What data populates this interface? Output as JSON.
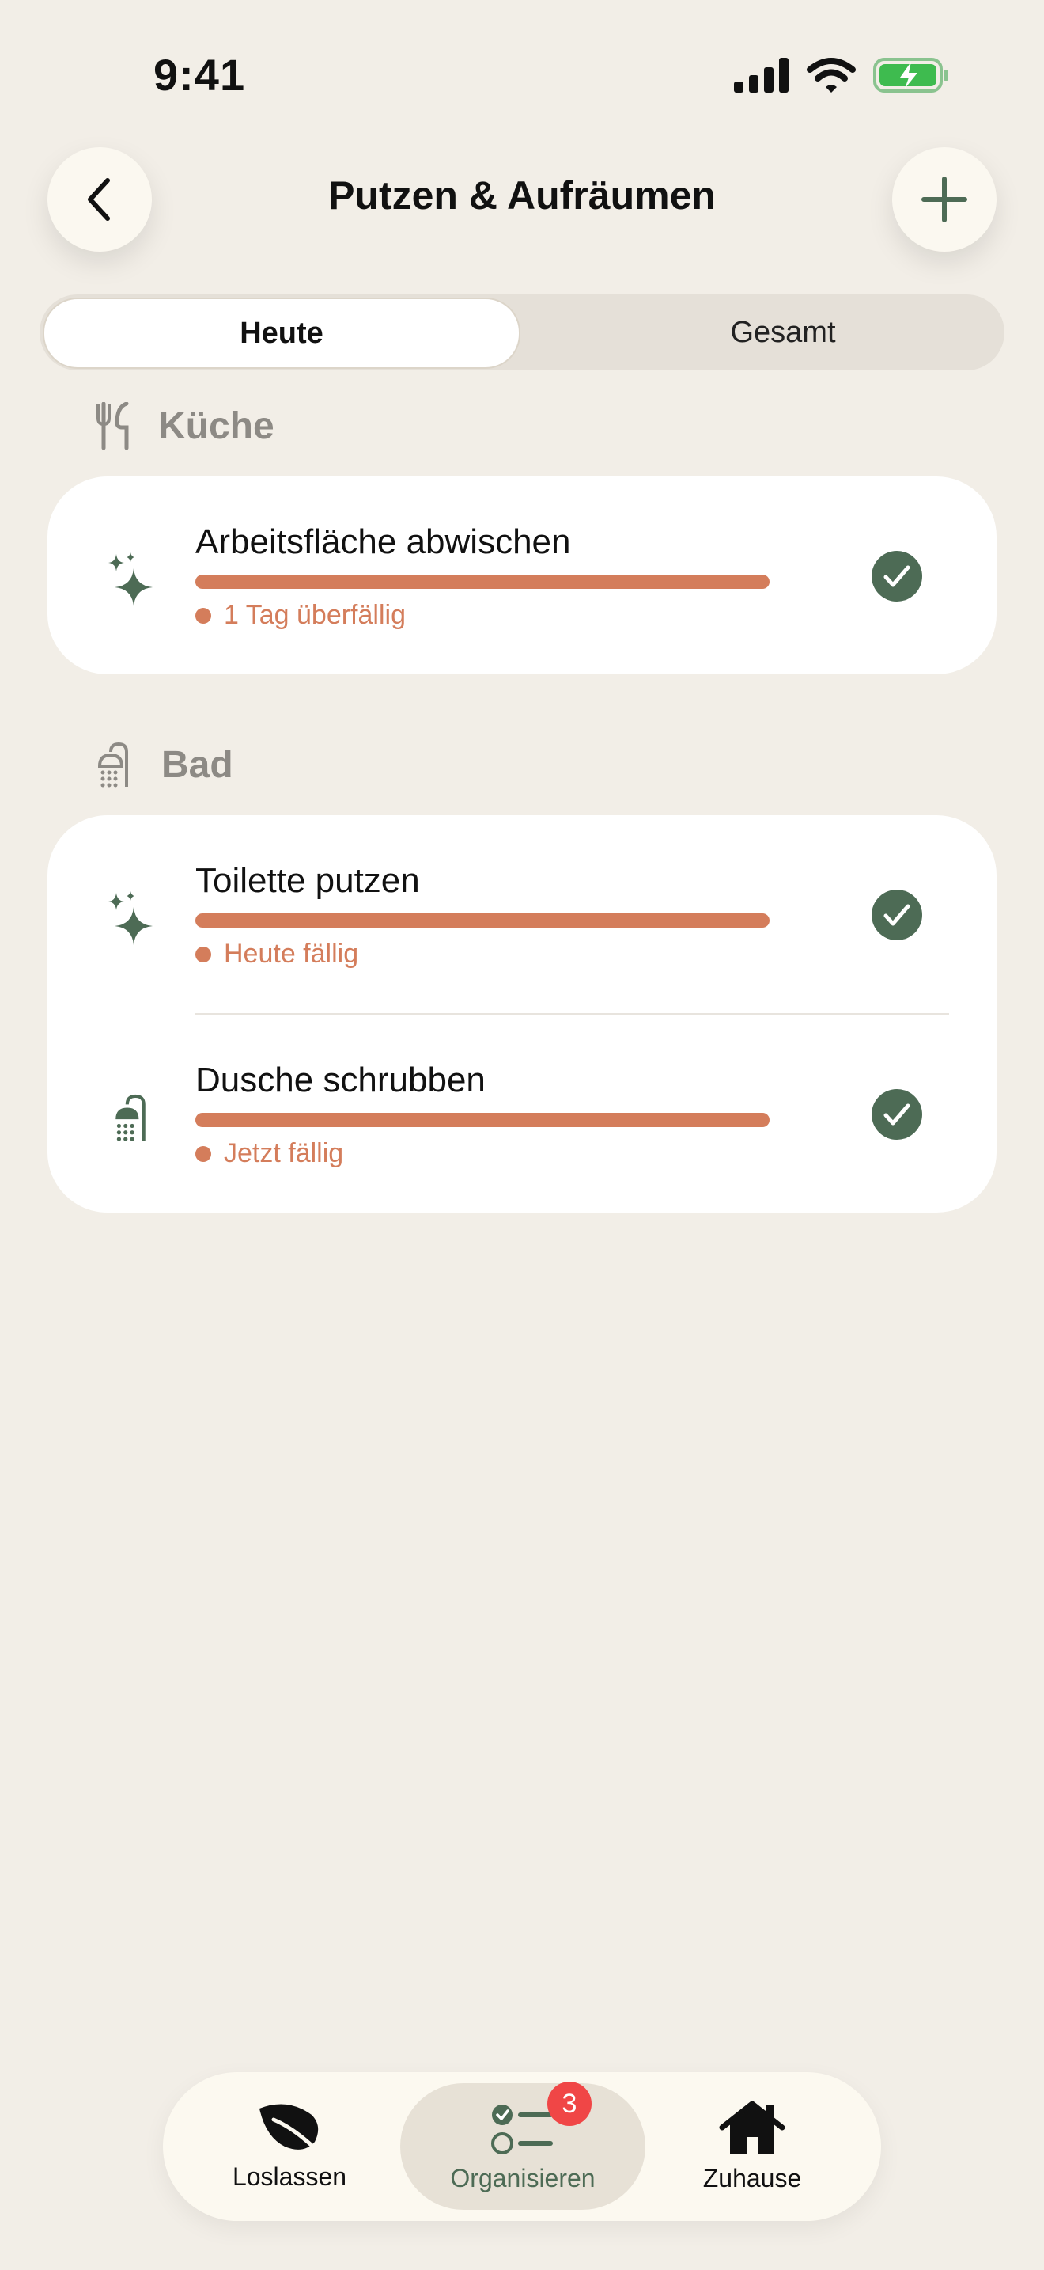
{
  "status_bar": {
    "time": "9:41"
  },
  "nav": {
    "title": "Putzen & Aufräumen"
  },
  "segments": {
    "active": "Heute",
    "inactive": "Gesamt"
  },
  "sections": [
    {
      "label": "Küche",
      "tasks": [
        {
          "title": "Arbeitsfläche abwischen",
          "status": "1 Tag überfällig",
          "icon": "sparkles-icon",
          "progress": 1.0
        }
      ]
    },
    {
      "label": "Bad",
      "tasks": [
        {
          "title": "Toilette putzen",
          "status": "Heute fällig",
          "icon": "sparkles-icon",
          "progress": 1.0
        },
        {
          "title": "Dusche schrubben",
          "status": "Jetzt fällig",
          "icon": "shower-icon",
          "progress": 1.0
        }
      ]
    }
  ],
  "tabbar": {
    "items": [
      {
        "label": "Loslassen",
        "icon": "leaf-icon"
      },
      {
        "label": "Organisieren",
        "icon": "checklist-icon",
        "badge": "3",
        "selected": true
      },
      {
        "label": "Zuhause",
        "icon": "house-icon"
      }
    ]
  },
  "colors": {
    "accent": "#4d6b55",
    "overdue": "#d47d5b",
    "background": "#f2eee7",
    "badge": "#f04646"
  }
}
